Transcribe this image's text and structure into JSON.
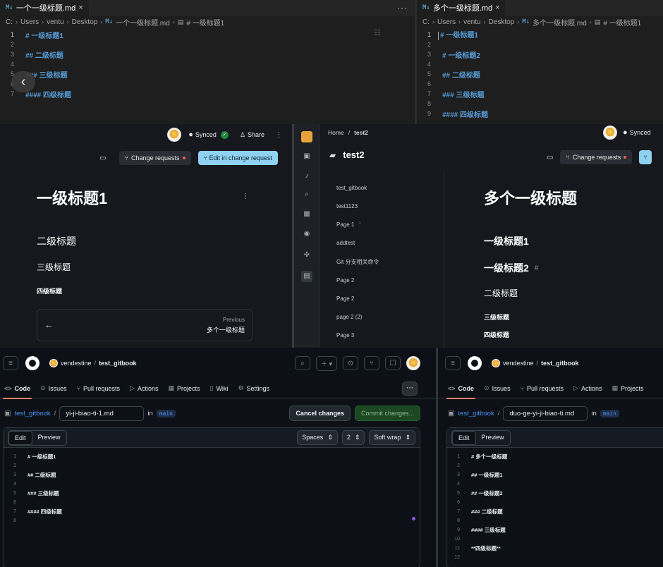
{
  "vscode_left": {
    "tab_label": "一个一级标题.md",
    "more_label": "···",
    "breadcrumb": [
      "C:",
      "Users",
      "ventu",
      "Desktop",
      "一个一级标题.md",
      "# 一级标题1"
    ],
    "lines": [
      {
        "n": "1",
        "t": "# 一级标题1"
      },
      {
        "n": "2",
        "t": ""
      },
      {
        "n": "3",
        "t": "## 二级标题"
      },
      {
        "n": "4",
        "t": ""
      },
      {
        "n": "5",
        "t": "### 三级标题"
      },
      {
        "n": "6",
        "t": ""
      },
      {
        "n": "7",
        "t": "#### 四级标题"
      }
    ]
  },
  "vscode_right": {
    "tab_label": "多个一级标题.md",
    "breadcrumb": [
      "C:",
      "Users",
      "ventu",
      "Desktop",
      "多个一级标题.md",
      "# 一级标题1"
    ],
    "lines": [
      {
        "n": "1",
        "t": "# 一级标题1"
      },
      {
        "n": "2",
        "t": ""
      },
      {
        "n": "3",
        "t": "# 一级标题2"
      },
      {
        "n": "4",
        "t": ""
      },
      {
        "n": "5",
        "t": "## 二级标题"
      },
      {
        "n": "6",
        "t": ""
      },
      {
        "n": "7",
        "t": "### 三级标题"
      },
      {
        "n": "8",
        "t": ""
      },
      {
        "n": "9",
        "t": "#### 四级标题"
      }
    ]
  },
  "gitbook_left": {
    "synced_label": "Synced",
    "share_label": "Share",
    "change_requests_label": "Change requests",
    "edit_button": "Edit in change request",
    "h1": "一级标题1",
    "h2": "二级标题",
    "h3": "三级标题",
    "h4": "四级标题",
    "prev_label": "Previous",
    "prev_title": "多个一级标题"
  },
  "gitbook_right": {
    "breadcrumb_home": "Home",
    "breadcrumb_sep": "/",
    "breadcrumb_current": "test2",
    "space_title": "test2",
    "synced_label": "Synced",
    "change_requests_label": "Change requests",
    "nav_items": [
      "test_gitbook",
      "test1123",
      "Page 1",
      "addtest",
      "Git 分支相关命令",
      "Page 2",
      "Page 2",
      "page 2 (2)",
      "Page 3"
    ],
    "page_title": "多个一级标题",
    "h_a": "一级标题1",
    "h_b": "一级标题2",
    "h_b_anchor": "#",
    "h2": "二级标题",
    "h3": "三级标题",
    "h4": "四级标题"
  },
  "github_left": {
    "owner": "vendestine",
    "repo": "test_gitbook",
    "tabs": [
      "Code",
      "Issues",
      "Pull requests",
      "Actions",
      "Projects",
      "Wiki",
      "Settings"
    ],
    "repo_link": "test_gitbook",
    "path_sep": "/",
    "filename": "yi-ji-biao-ti-1.md",
    "in_label": "in",
    "branch": "main",
    "cancel_label": "Cancel changes",
    "commit_label": "Commit changes...",
    "edit_tab": "Edit",
    "preview_tab": "Preview",
    "indent_mode": "Spaces",
    "indent_size": "2",
    "wrap_mode": "Soft wrap",
    "lines": [
      {
        "n": "1",
        "t": "# 一级标题1"
      },
      {
        "n": "2",
        "t": ""
      },
      {
        "n": "3",
        "t": "## 二级标题"
      },
      {
        "n": "4",
        "t": ""
      },
      {
        "n": "5",
        "t": "### 三级标题"
      },
      {
        "n": "6",
        "t": ""
      },
      {
        "n": "7",
        "t": "#### 四级标题"
      },
      {
        "n": "8",
        "t": ""
      }
    ]
  },
  "github_right": {
    "owner": "vendestine",
    "repo": "test_gitbook",
    "tabs": [
      "Code",
      "Issues",
      "Pull requests",
      "Actions",
      "Projects"
    ],
    "repo_link": "test_gitbook",
    "path_sep": "/",
    "filename": "duo-ge-yi-ji-biao-ti.md",
    "in_label": "in",
    "branch": "main",
    "edit_tab": "Edit",
    "preview_tab": "Preview",
    "lines": [
      {
        "n": "1",
        "t": "# 多个一级标题"
      },
      {
        "n": "2",
        "t": ""
      },
      {
        "n": "3",
        "t": "## 一级标题1"
      },
      {
        "n": "4",
        "t": ""
      },
      {
        "n": "5",
        "t": "## 一级标题2"
      },
      {
        "n": "6",
        "t": ""
      },
      {
        "n": "7",
        "t": "### 二级标题"
      },
      {
        "n": "8",
        "t": ""
      },
      {
        "n": "9",
        "t": "#### 三级标题"
      },
      {
        "n": "10",
        "t": ""
      },
      {
        "n": "11",
        "t": "**四级标题**"
      },
      {
        "n": "12",
        "t": ""
      }
    ]
  }
}
